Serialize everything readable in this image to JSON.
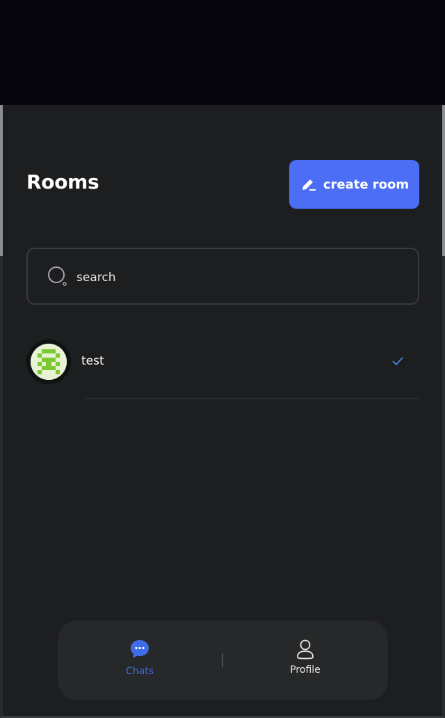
{
  "header": {
    "title": "Rooms",
    "create_button_label": "create room"
  },
  "search": {
    "placeholder": "search",
    "value": ""
  },
  "rooms": [
    {
      "name": "test",
      "status_icon": "check-icon"
    }
  ],
  "nav": {
    "items": [
      {
        "label": "Chats",
        "icon": "chat-bubble-icon",
        "active": true
      },
      {
        "label": "Profile",
        "icon": "user-icon",
        "active": false
      }
    ]
  },
  "colors": {
    "accent": "#4b6ef5",
    "active_nav": "#3f6de8",
    "background": "#1d1e20",
    "top_bar": "#07050d",
    "avatar_green": "#7cc832"
  }
}
